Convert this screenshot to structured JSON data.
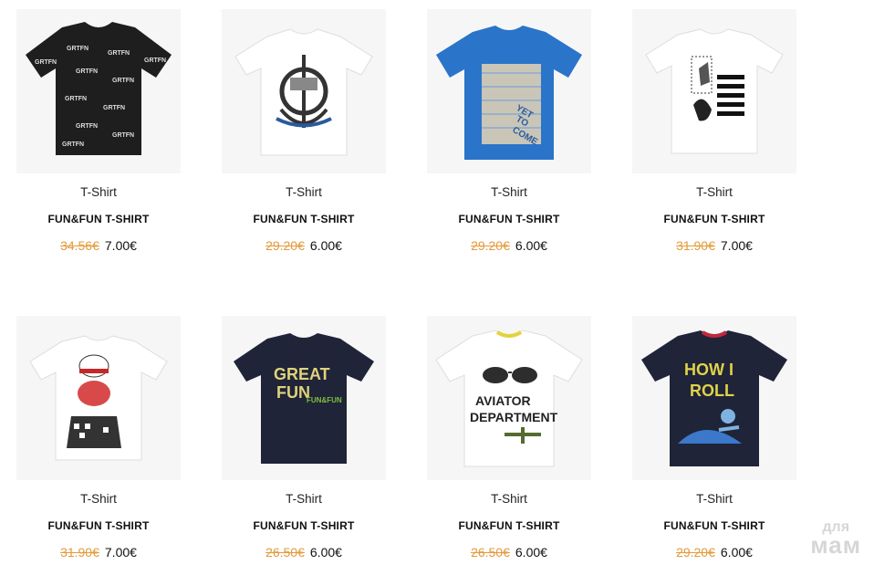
{
  "products": [
    {
      "category": "T-Shirt",
      "name": "FUN&FUN T-SHIRT",
      "old_price": "34.56€",
      "new_price": "7.00€",
      "shirt_color": "#1e1e1e",
      "print": "black-logo-allover"
    },
    {
      "category": "T-Shirt",
      "name": "FUN&FUN T-SHIRT",
      "old_price": "29.20€",
      "new_price": "6.00€",
      "shirt_color": "#ffffff",
      "print": "anchor-emblem"
    },
    {
      "category": "T-Shirt",
      "name": "FUN&FUN T-SHIRT",
      "old_price": "29.20€",
      "new_price": "6.00€",
      "shirt_color": "#2a74c9",
      "print": "yet-to-come"
    },
    {
      "category": "T-Shirt",
      "name": "FUN&FUN T-SHIRT",
      "old_price": "31.90€",
      "new_price": "7.00€",
      "shirt_color": "#ffffff",
      "print": "photo-stripes"
    },
    {
      "category": "T-Shirt",
      "name": "FUN&FUN T-SHIRT",
      "old_price": "31.90€",
      "new_price": "7.00€",
      "shirt_color": "#ffffff",
      "print": "hat-character"
    },
    {
      "category": "T-Shirt",
      "name": "FUN&FUN T-SHIRT",
      "old_price": "26.50€",
      "new_price": "6.00€",
      "shirt_color": "#1f2438",
      "print": "great-fun"
    },
    {
      "category": "T-Shirt",
      "name": "FUN&FUN T-SHIRT",
      "old_price": "26.50€",
      "new_price": "6.00€",
      "shirt_color": "#ffffff",
      "print": "aviator-department"
    },
    {
      "category": "T-Shirt",
      "name": "FUN&FUN T-SHIRT",
      "old_price": "29.20€",
      "new_price": "6.00€",
      "shirt_color": "#1f2438",
      "print": "how-i-roll"
    }
  ],
  "colors": {
    "old_price": "#e39a3b",
    "text": "#111111"
  },
  "watermark": {
    "line1": "для",
    "line2": "мам"
  }
}
